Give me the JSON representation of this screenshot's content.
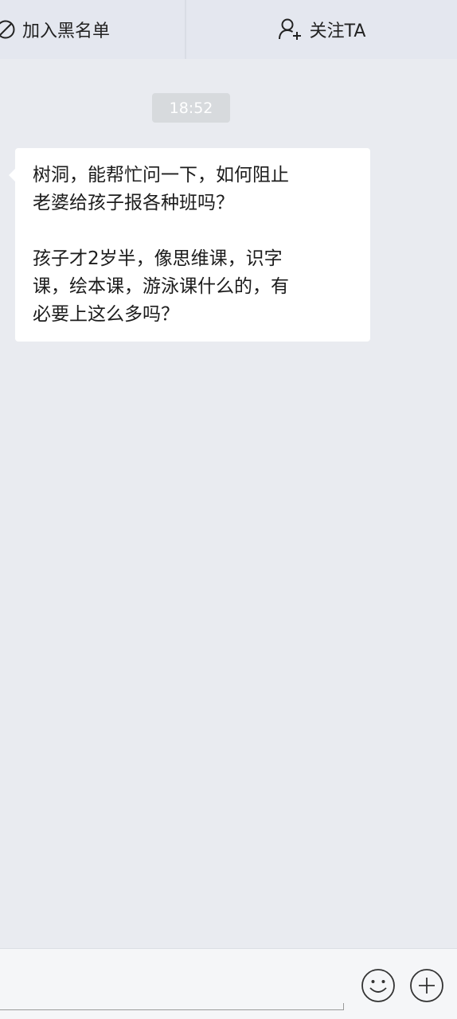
{
  "header": {
    "blacklist_label": "加入黑名单",
    "blacklist_icon": "block-icon",
    "follow_label": "关注TA",
    "follow_icon": "add-user-icon"
  },
  "chat": {
    "timestamp": "18:52",
    "messages": [
      {
        "paragraphs": [
          "树洞，能帮忙问一下，如何阻止\n老婆给孩子报各种班吗？",
          "孩子才2岁半，像思维课，识字\n课，绘本课，游泳课什么的，有\n必要上这么多吗？"
        ]
      }
    ]
  },
  "composer": {
    "emoji_icon": "emoji-icon",
    "plus_icon": "plus-icon"
  }
}
